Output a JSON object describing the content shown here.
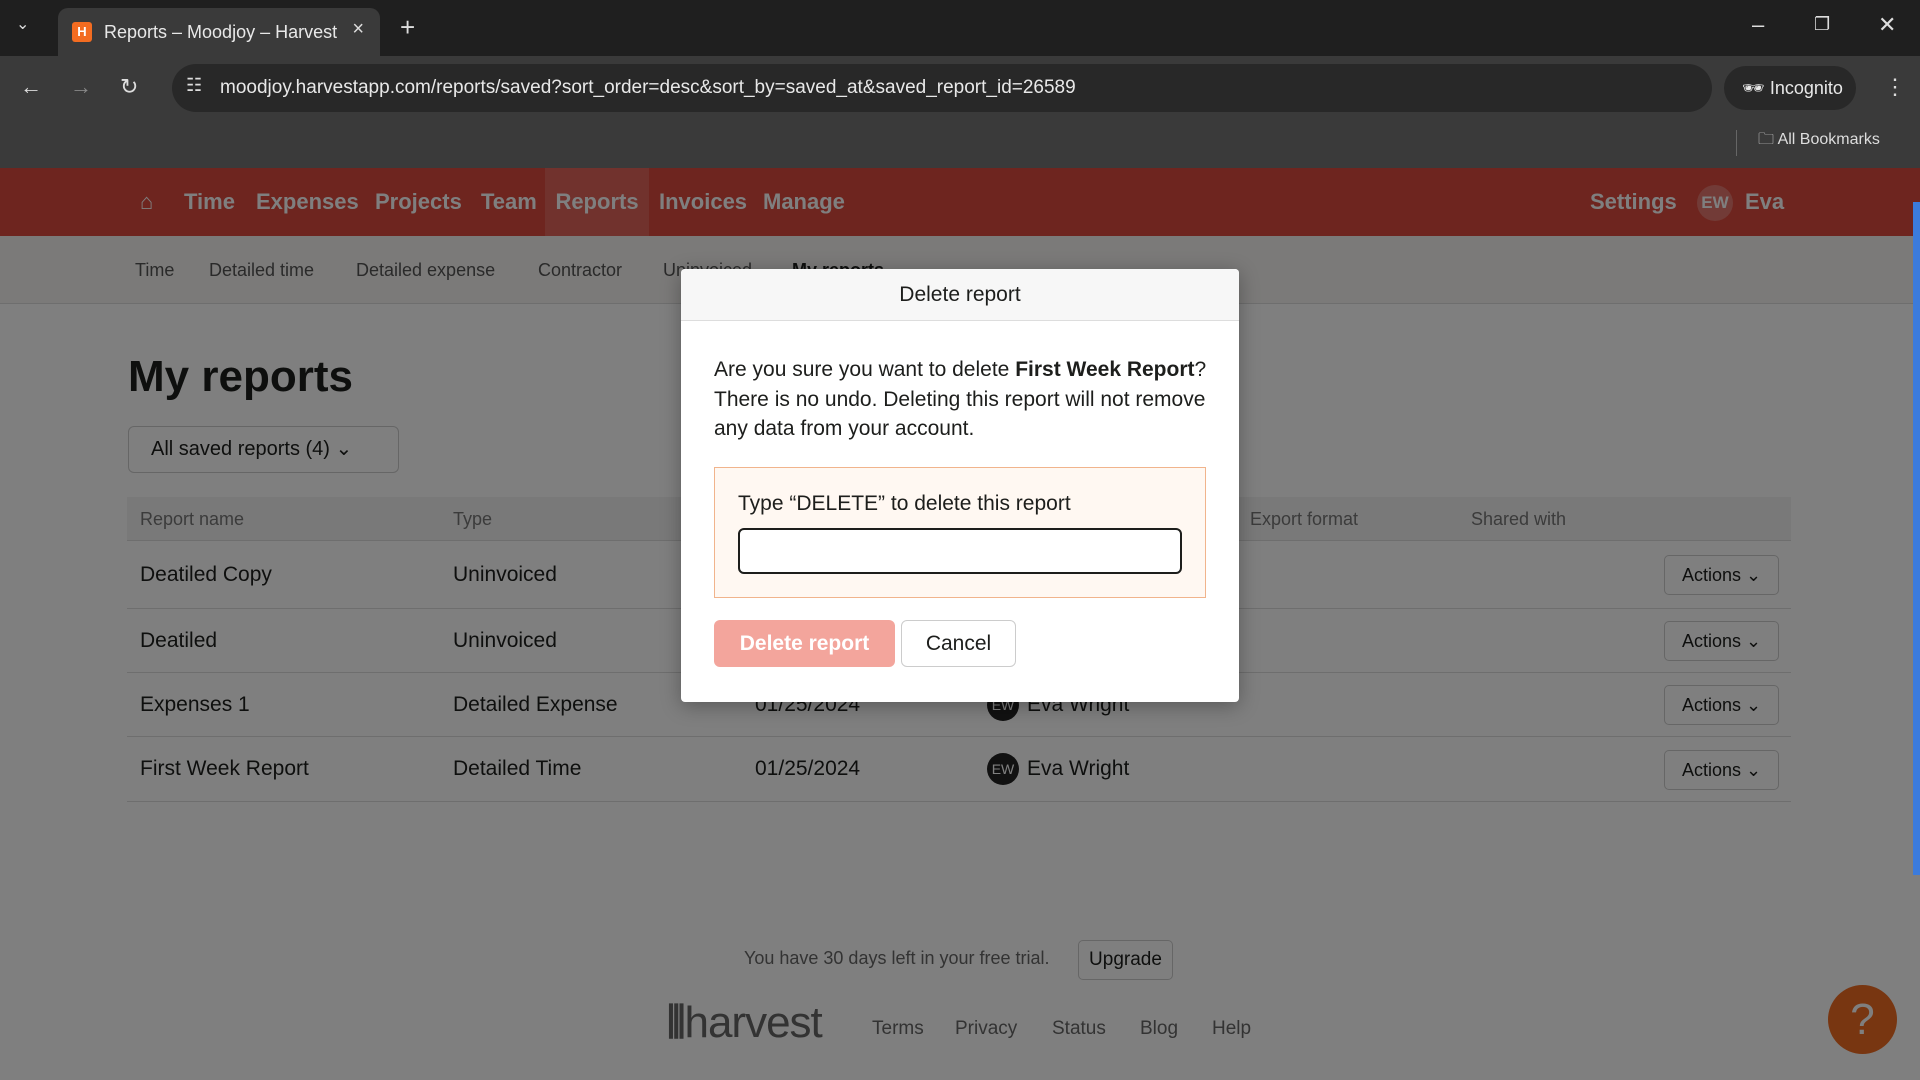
{
  "browser": {
    "tab_title": "Reports – Moodjoy – Harvest",
    "favicon": "H",
    "url": "moodjoy.harvestapp.com/reports/saved?sort_order=desc&sort_by=saved_at&saved_report_id=26589",
    "incognito": "Incognito",
    "bookmarks": "All Bookmarks"
  },
  "nav": {
    "items": [
      "Time",
      "Expenses",
      "Projects",
      "Team",
      "Reports",
      "Invoices",
      "Manage"
    ],
    "active": "Reports",
    "settings": "Settings",
    "avatar": "EW",
    "user": "Eva",
    "brand_color": "#dd4a3e"
  },
  "subnav": [
    "Time",
    "Detailed time",
    "Detailed expense",
    "Contractor",
    "Uninvoiced",
    "My reports"
  ],
  "page": {
    "title": "My reports",
    "filter": "All saved reports (4)"
  },
  "table": {
    "headers": [
      "Report name",
      "Type",
      "",
      "",
      "Export format",
      "Shared with"
    ],
    "rows": [
      {
        "name": "Deatiled Copy",
        "type": "Uninvoiced",
        "date": "",
        "owner": "",
        "avatar": "",
        "actions": "Actions"
      },
      {
        "name": "Deatiled",
        "type": "Uninvoiced",
        "date": "",
        "owner": "",
        "avatar": "",
        "actions": "Actions"
      },
      {
        "name": "Expenses 1",
        "type": "Detailed Expense",
        "date": "01/25/2024",
        "owner": "Eva Wright",
        "avatar": "EW",
        "actions": "Actions"
      },
      {
        "name": "First Week Report",
        "type": "Detailed Time",
        "date": "01/25/2024",
        "owner": "Eva Wright",
        "avatar": "EW",
        "actions": "Actions"
      }
    ]
  },
  "footer": {
    "trial": "You have 30 days left in your free trial.",
    "upgrade": "Upgrade",
    "logo": "harvest",
    "links": [
      "Terms",
      "Privacy",
      "Status",
      "Blog",
      "Help"
    ],
    "help": "?"
  },
  "modal": {
    "title": "Delete report",
    "text_pre": "Are you sure you want to delete ",
    "report_name": "First Week Report",
    "text_post": "? There is no undo. Deleting this report will not remove any data from your account.",
    "confirm_label": "Type “DELETE” to delete this report",
    "input_value": "",
    "delete": "Delete report",
    "cancel": "Cancel"
  }
}
